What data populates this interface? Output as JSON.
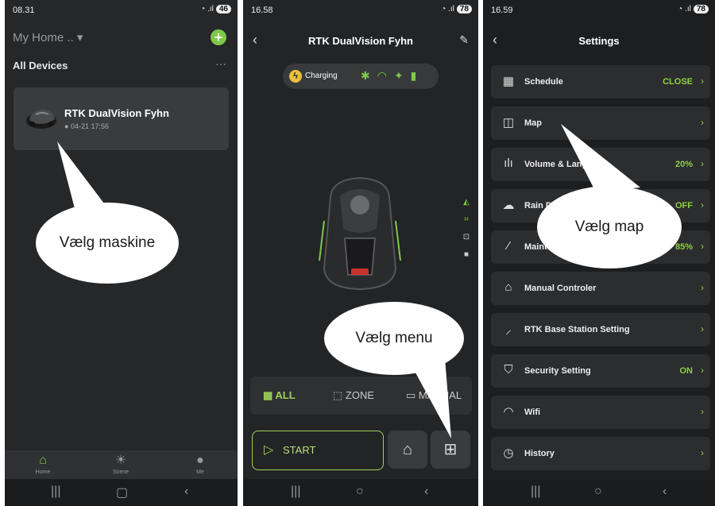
{
  "panel1": {
    "status": {
      "time": "08.31",
      "battery": "46"
    },
    "home_title": "My Home .. ▾",
    "section": "All Devices",
    "device": {
      "name": "RTK DualVision Fyhn",
      "timestamp": "04-21 17:56"
    },
    "tabs": [
      {
        "label": "Home"
      },
      {
        "label": "Scene"
      },
      {
        "label": "Me"
      }
    ],
    "callout": "Vælg maskine"
  },
  "panel2": {
    "status": {
      "time": "16.58",
      "battery": "78"
    },
    "title": "RTK DualVision Fyhn",
    "charging_label": "Charging",
    "modes": [
      "ALL",
      "ZONE",
      "MANUAL"
    ],
    "start_label": "START",
    "callout": "Vælg menu"
  },
  "panel3": {
    "status": {
      "time": "16.59",
      "battery": "78"
    },
    "title": "Settings",
    "rows": [
      {
        "label": "Schedule",
        "value": "CLOSE",
        "icon": "calendar-icon"
      },
      {
        "label": "Map",
        "value": "",
        "icon": "map-icon"
      },
      {
        "label": "Volume & Language",
        "value": "20%",
        "icon": "volume-icon"
      },
      {
        "label": "Rain Detection",
        "value": "OFF",
        "icon": "rain-icon"
      },
      {
        "label": "Maintenance",
        "value": "85%",
        "icon": "brush-icon"
      },
      {
        "label": "Manual Controler",
        "value": "",
        "icon": "controller-icon"
      },
      {
        "label": "RTK Base Station Setting",
        "value": "",
        "icon": "antenna-icon"
      },
      {
        "label": "Security Setting",
        "value": "ON",
        "icon": "shield-icon"
      },
      {
        "label": "Wifi",
        "value": "",
        "icon": "wifi-icon"
      },
      {
        "label": "History",
        "value": "",
        "icon": "clock-icon"
      }
    ],
    "callout": "Vælg map"
  },
  "colors": {
    "accent": "#8fd13f",
    "background": "#1e1f21",
    "card": "#2c2d2f"
  }
}
